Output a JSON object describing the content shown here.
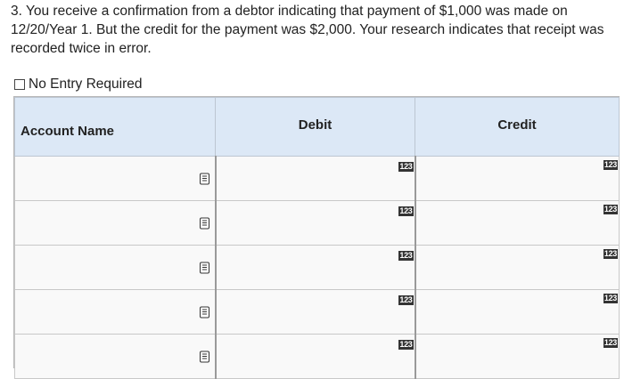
{
  "question": {
    "text": "3. You receive a confirmation from a debtor indicating that payment of $1,000 was made on 12/20/Year 1. But the credit for the payment was $2,000. Your research indicates that receipt was recorded twice in error."
  },
  "no_entry": {
    "label": "No Entry Required",
    "checked": false
  },
  "journal": {
    "headers": {
      "account": "Account Name",
      "debit": "Debit",
      "credit": "Credit"
    },
    "rows": [
      {
        "account": "",
        "debit": "",
        "credit": "",
        "debit_badge": "123",
        "credit_badge": "123"
      },
      {
        "account": "",
        "debit": "",
        "credit": "",
        "debit_badge": "123",
        "credit_badge": "123"
      },
      {
        "account": "",
        "debit": "",
        "credit": "",
        "debit_badge": "123",
        "credit_badge": "123"
      },
      {
        "account": "",
        "debit": "",
        "credit": "",
        "debit_badge": "123",
        "credit_badge": "123"
      },
      {
        "account": "",
        "debit": "",
        "credit": "",
        "debit_badge": "123",
        "credit_badge": "123"
      }
    ]
  },
  "icons": {
    "account_dropdown": "list-icon",
    "number_input": "numeric-123-icon"
  }
}
